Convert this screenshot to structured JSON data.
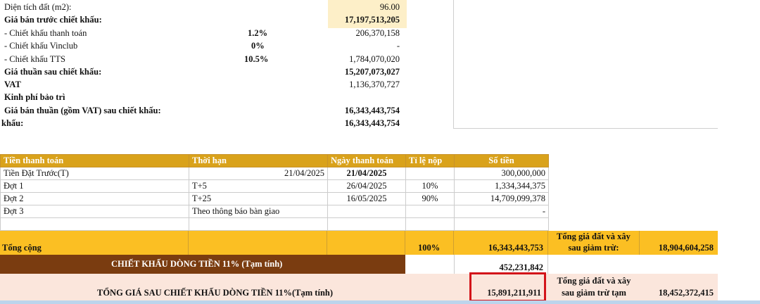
{
  "summary": {
    "dien_tich": {
      "label": "Diện tích đất (m2):",
      "value": "96.00"
    },
    "gia_ban": {
      "label": "Giá bán trước chiết khấu:",
      "value": "17,197,513,205"
    },
    "ck1": {
      "label": "- Chiết khấu thanh toán",
      "percent": "1.2%",
      "value": "206,370,158"
    },
    "ck_vinclub": {
      "label": "- Chiết khấu Vinclub",
      "percent": "0%",
      "value": "-"
    },
    "ck_tts": {
      "label": "- Chiết khấu TTS",
      "percent": "10.5%",
      "value": "1,784,070,020"
    },
    "gia_thuan": {
      "label": "Giá thuần sau chiết khấu:",
      "value": "15,207,073,027"
    },
    "vat": {
      "label": "VAT",
      "value": "1,136,370,727"
    },
    "kinh_phi": {
      "label": "Kinh phí bảo trì",
      "value": ""
    },
    "gia_ban_thuan": {
      "label": "Giá bán thuần (gồm VAT) sau chiết khấu:",
      "value": "16,343,443,754"
    },
    "khau": {
      "label": "khấu:",
      "value": "16,343,443,754"
    }
  },
  "payment_table": {
    "headers": [
      "Tiền thanh toán",
      "Thời hạn",
      "Ngày thanh toán",
      "Tỉ lệ nộp",
      "Số tiền"
    ],
    "rows": [
      {
        "name": "Tiền Đặt Trước(T)",
        "term": "21/04/2025",
        "date": "21/04/2025",
        "ratio": "",
        "amount": "300,000,000"
      },
      {
        "name": "Đợt 1",
        "term": "T+5",
        "date": "26/04/2025",
        "ratio": "10%",
        "amount": "1,334,344,375"
      },
      {
        "name": "Đợt 2",
        "term": "T+25",
        "date": "16/05/2025",
        "ratio": "90%",
        "amount": "14,709,099,378"
      },
      {
        "name": "Đợt 3",
        "term": "Theo thông báo bàn giao",
        "date": "",
        "ratio": "",
        "amount": "-"
      },
      {
        "name": "",
        "term": "",
        "date": "",
        "ratio": "",
        "amount": ""
      }
    ]
  },
  "totals": {
    "label": "Tổng cộng",
    "percent": "100%",
    "amount": "16,343,443,753",
    "land_label_1": "Tổng giá đất và xây",
    "land_label_2": "sau giảm trừ:",
    "land_value": "18,904,604,258"
  },
  "discount": {
    "label": "CHIẾT KHẤU DÒNG TIỀN 11% (Tạm tính)",
    "amount": "452,231,842"
  },
  "after_discount": {
    "label": "TỔNG GIÁ SAU CHIẾT KHẤU DÒNG TIỀN 11%(Tạm tính)",
    "amount": "15,891,211,911",
    "land_label_1": "Tổng giá đất và xây",
    "land_label_2": "sau giảm trừ tạm",
    "land_value": "18,452,372,415"
  },
  "colors": {
    "header_gold": "#d9a21b",
    "total_yellow": "#fbbf23",
    "discount_brown": "#7a3c10",
    "highlight_red": "#d3141a"
  }
}
